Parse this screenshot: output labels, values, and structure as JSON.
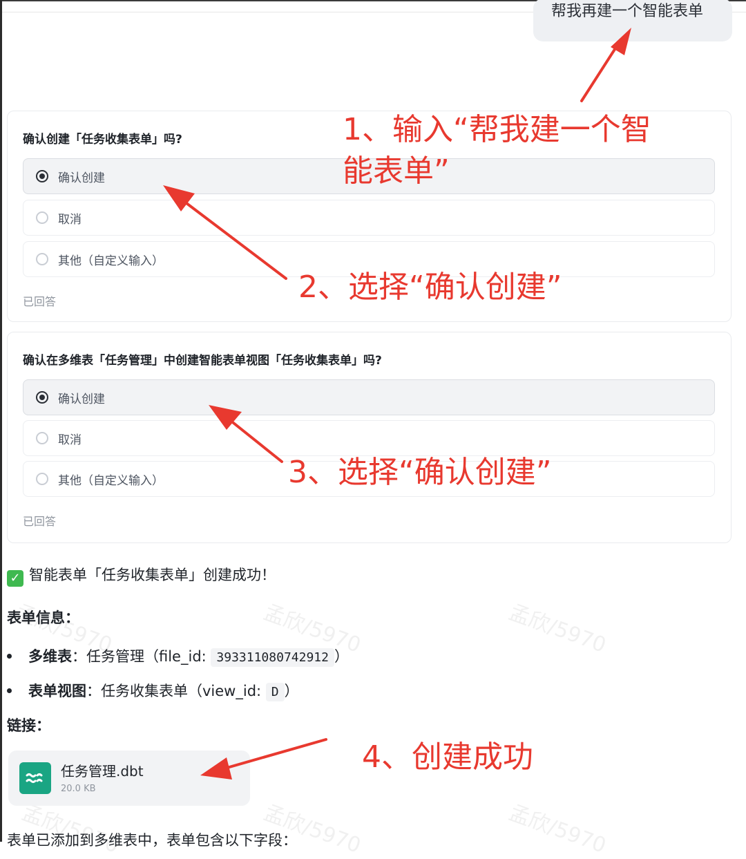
{
  "user_message": "帮我再建一个智能表单",
  "card1": {
    "question": "确认创建「任务收集表单」吗?",
    "options": [
      "确认创建",
      "取消",
      "其他（自定义输入）"
    ],
    "status": "已回答"
  },
  "card2": {
    "question": "确认在多维表「任务管理」中创建智能表单视图「任务收集表单」吗?",
    "options": [
      "确认创建",
      "取消",
      "其他（自定义输入）"
    ],
    "status": "已回答"
  },
  "result": {
    "success_text": "智能表单「任务收集表单」创建成功！",
    "info_heading": "表单信息：",
    "bullet1_label": "多维表",
    "bullet1_text": "：任务管理（file_id: ",
    "bullet1_code": "393311080742912",
    "bullet1_end": "）",
    "bullet2_label": "表单视图",
    "bullet2_text": "：任务收集表单（view_id: ",
    "bullet2_code": "D",
    "bullet2_end": "）",
    "link_heading": "链接：",
    "file_name": "任务管理.dbt",
    "file_size": "20.0 KB",
    "footer_text": "表单已添加到多维表中，表单包含以下字段："
  },
  "annotations": {
    "step1_line1": "1、输入“帮我建一个智",
    "step1_line2": "能表单”",
    "step2": "2、选择“确认创建”",
    "step3": "3、选择“确认创建”",
    "step4": "4、创建成功"
  },
  "watermark": "孟欣/5970",
  "colors": {
    "annotation": "#e8392f",
    "file_icon": "#1aa583",
    "check": "#3fb950"
  }
}
